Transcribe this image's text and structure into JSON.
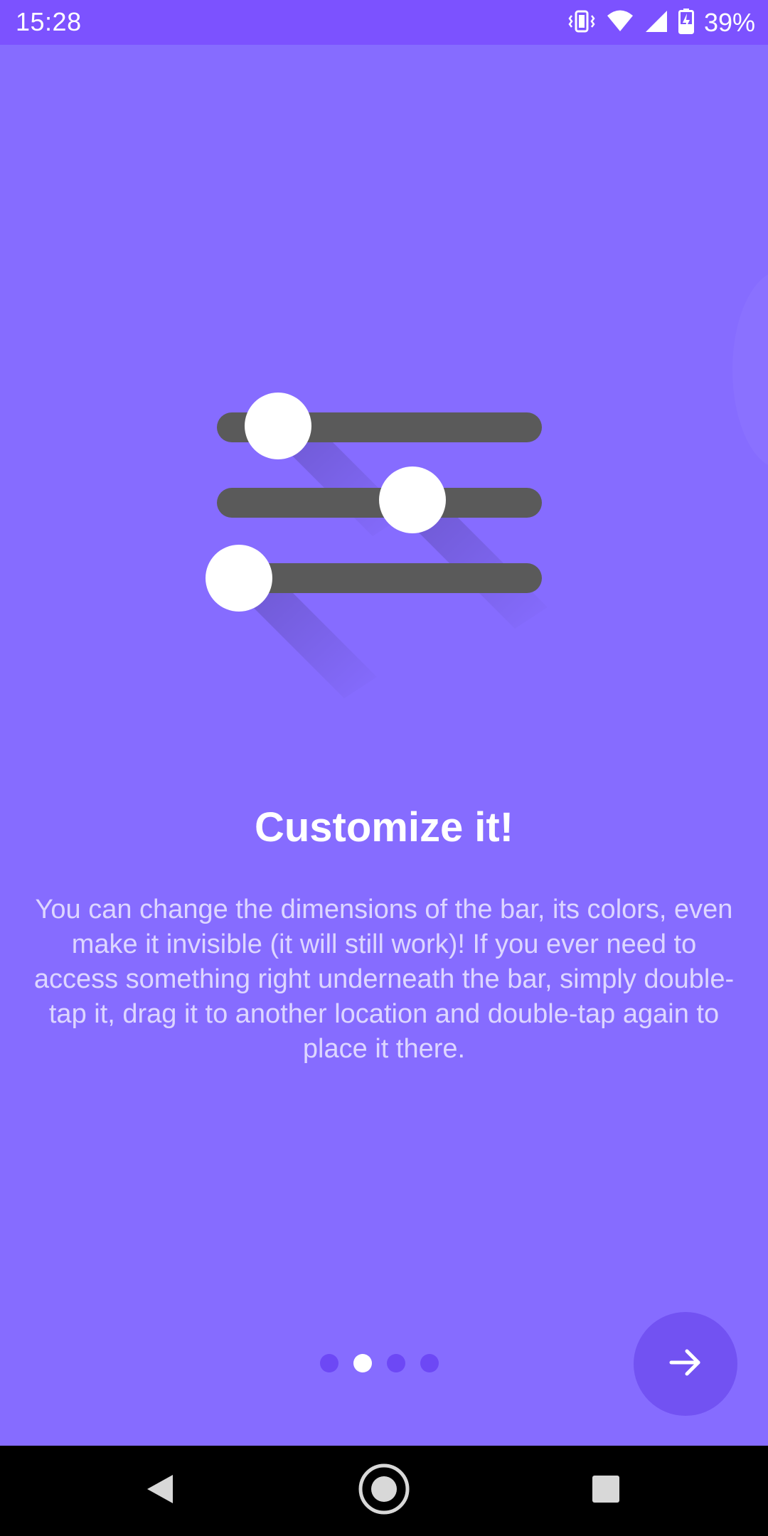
{
  "status_bar": {
    "time": "15:28",
    "battery_percent": "39%",
    "icons": [
      "vibrate-icon",
      "wifi-icon",
      "signal-icon",
      "battery-charging-icon"
    ]
  },
  "colors": {
    "background": "#866cff",
    "status_bar": "#7c52ff",
    "fab": "#7252f2",
    "dot_inactive": "#6d48f5",
    "dot_active": "#ffffff",
    "slider_track": "#5a5a5a",
    "slider_knob": "#ffffff"
  },
  "illustration": {
    "icon": "sliders-icon",
    "sliders": [
      {
        "level": 0.2
      },
      {
        "level": 0.6
      },
      {
        "level": 0.08
      }
    ]
  },
  "onboarding": {
    "title": "Customize it!",
    "description": "You can change the dimensions of the bar, its colors, even make it invisible (it will still work)! If you ever need to access something right underneath the bar, simply double-tap it, drag it to another location and double-tap again to place it there.",
    "page_indicator": {
      "total": 4,
      "current": 2
    },
    "next_icon": "arrow-right-icon"
  },
  "navigation_bar": {
    "buttons": [
      "back-icon",
      "home-icon",
      "recents-icon"
    ]
  }
}
